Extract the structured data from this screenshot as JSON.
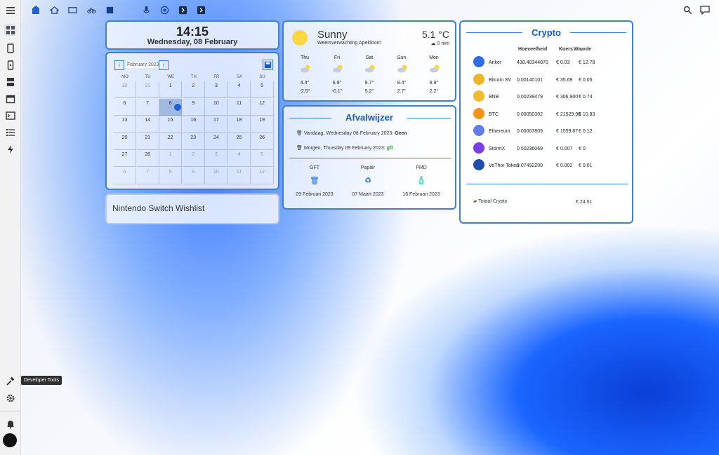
{
  "sidebar": {
    "items": [
      "dashboard",
      "tablet",
      "phone",
      "server",
      "calendar",
      "terminal",
      "list",
      "bolt"
    ],
    "bottom": [
      "hammer",
      "settings",
      "notifications",
      "avatar"
    ]
  },
  "tooltip": "Developer Tools",
  "clock": {
    "time": "14:15",
    "date": "Wednesday, 08 February"
  },
  "calendar": {
    "month_label": "February 2023",
    "weekdays": [
      "MO",
      "TU",
      "WE",
      "TH",
      "FR",
      "SA",
      "SU"
    ],
    "weeks": [
      [
        "30",
        "31",
        "1",
        "2",
        "3",
        "4",
        "5"
      ],
      [
        "6",
        "7",
        "8",
        "9",
        "10",
        "11",
        "12"
      ],
      [
        "13",
        "14",
        "15",
        "16",
        "17",
        "18",
        "19"
      ],
      [
        "20",
        "21",
        "22",
        "23",
        "24",
        "25",
        "26"
      ],
      [
        "27",
        "28",
        "1",
        "2",
        "3",
        "4",
        "5"
      ],
      [
        "6",
        "7",
        "8",
        "9",
        "10",
        "11",
        "12"
      ]
    ]
  },
  "wishlist": {
    "title": "Nintendo Switch Wishlist"
  },
  "weather": {
    "condition": "Sunny",
    "location": "Weersverwachting Apeldoorn",
    "temp": "5.1 °C",
    "precip": "0 mm",
    "forecast": [
      {
        "day": "Thu",
        "high": "4.4°",
        "low": "-2.5°"
      },
      {
        "day": "Fri",
        "high": "6.9°",
        "low": "-0.1°"
      },
      {
        "day": "Sat",
        "high": "8.7°",
        "low": "5.2°"
      },
      {
        "day": "Sun",
        "high": "8.4°",
        "low": "2.7°"
      },
      {
        "day": "Mon",
        "high": "8.9°",
        "low": "2.2°"
      }
    ]
  },
  "afval": {
    "title": "Afvalwijzer",
    "today_text": "Vandaag, Wednesday 08 February 2023:",
    "today_value": "Geen",
    "tomorrow_text": "Morgen, Thursday 09 February 2023:",
    "tomorrow_value": "gft",
    "bins": [
      {
        "name": "GFT",
        "date": "09 Februari 2023"
      },
      {
        "name": "Papier",
        "date": "07 Maart 2023"
      },
      {
        "name": "PMD",
        "date": "16 Februari 2023"
      }
    ]
  },
  "crypto": {
    "title": "Crypto",
    "headers": [
      "Hoeveelheid",
      "Koers",
      "Waarde"
    ],
    "rows": [
      {
        "name": "Anker",
        "qty": "438.40344870",
        "rate": "€ 0.03",
        "value": "€ 12.78",
        "color": "#2f6de0"
      },
      {
        "name": "Bitcoin SV",
        "qty": "0.00140101",
        "rate": "€ 35.69",
        "value": "€ 0.05",
        "color": "#f0b429"
      },
      {
        "name": "BNB",
        "qty": "0.00239479",
        "rate": "€ 306.900",
        "value": "€ 0.74",
        "color": "#f3ba2f"
      },
      {
        "name": "BTC",
        "qty": "0.00050302",
        "rate": "€ 21529.96",
        "value": "€ 10.83",
        "color": "#f7931a"
      },
      {
        "name": "Ethereum",
        "qty": "0.00007809",
        "rate": "€ 1559.87",
        "value": "€ 0.12",
        "color": "#627eea"
      },
      {
        "name": "StormX",
        "qty": "0.50236069",
        "rate": "€ 0.007",
        "value": "€ 0",
        "color": "#7b3fe4"
      },
      {
        "name": "VeThor Token",
        "qty": "3.07492200",
        "rate": "€ 0.002",
        "value": "€ 0.01",
        "color": "#1f4fa8"
      }
    ],
    "total_label": "Totaal Crypto",
    "total_value": "€ 24.51"
  }
}
